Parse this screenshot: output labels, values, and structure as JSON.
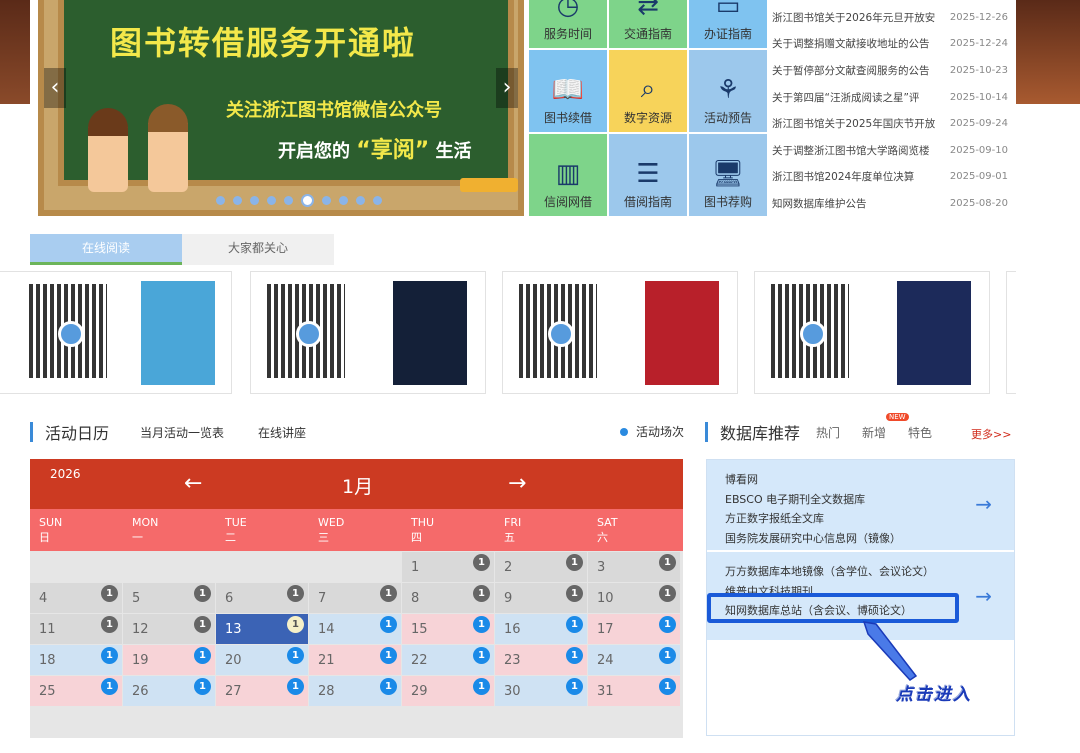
{
  "banner": {
    "title": "图书转借服务开通啦",
    "line1": "关注浙江图书馆微信公众号",
    "line2_pre": "开启您的",
    "line2_hl": "“享阅”",
    "line2_post": "生活",
    "dot_count": 10,
    "active_dot": 5
  },
  "tiles": [
    {
      "label": "服务时间",
      "icon": "clock-icon",
      "color": "t-green",
      "glyph": "◷"
    },
    {
      "label": "交通指南",
      "icon": "traffic-icon",
      "color": "t-green",
      "glyph": "⇄"
    },
    {
      "label": "办证指南",
      "icon": "card-icon",
      "color": "t-blue",
      "glyph": "▭"
    },
    {
      "label": "图书续借",
      "icon": "book-icon",
      "color": "t-blue",
      "glyph": "📖"
    },
    {
      "label": "数字资源",
      "icon": "search-icon",
      "color": "t-yellow",
      "glyph": "⌕"
    },
    {
      "label": "活动预告",
      "icon": "people-icon",
      "color": "t-lblue",
      "glyph": "⚘"
    },
    {
      "label": "信阅网借",
      "icon": "library-icon",
      "color": "t-green",
      "glyph": "▥"
    },
    {
      "label": "借阅指南",
      "icon": "guide-icon",
      "color": "t-lblue",
      "glyph": "☰"
    },
    {
      "label": "图书荐购",
      "icon": "computer-icon",
      "color": "t-lblue",
      "glyph": "🖥"
    }
  ],
  "news": [
    {
      "title": "浙江图书馆关于2026年元旦开放安",
      "date": "2025-12-26"
    },
    {
      "title": "关于调整捐赠文献接收地址的公告",
      "date": "2025-12-24"
    },
    {
      "title": "关于暂停部分文献查阅服务的公告",
      "date": "2025-10-23"
    },
    {
      "title": "关于第四届“汪浙成阅读之星”评",
      "date": "2025-10-14"
    },
    {
      "title": "浙江图书馆关于2025年国庆节开放",
      "date": "2025-09-24"
    },
    {
      "title": "关于调整浙江图书馆大学路阅览楼",
      "date": "2025-09-10"
    },
    {
      "title": "浙江图书馆2024年度单位决算",
      "date": "2025-09-01"
    },
    {
      "title": "知网数据库维护公告",
      "date": "2025-08-20"
    }
  ],
  "reading_tabs": [
    "在线阅读",
    "大家都关心"
  ],
  "books": [
    {
      "cover_color": "#4aa6d8"
    },
    {
      "cover_color": "#142038"
    },
    {
      "cover_color": "#b8202a"
    },
    {
      "cover_color": "#1c2a5a"
    }
  ],
  "activity": {
    "title": "活动日历",
    "links": [
      "当月活动一览表",
      "在线讲座"
    ],
    "legend": "活动场次"
  },
  "calendar": {
    "year": "2026",
    "month": "1月",
    "prev": "←",
    "next": "→",
    "weekdays": [
      {
        "en": "SUN",
        "zh": "日"
      },
      {
        "en": "MON",
        "zh": "一"
      },
      {
        "en": "TUE",
        "zh": "二"
      },
      {
        "en": "WED",
        "zh": "三"
      },
      {
        "en": "THU",
        "zh": "四"
      },
      {
        "en": "FRI",
        "zh": "五"
      },
      {
        "en": "SAT",
        "zh": "六"
      }
    ],
    "days": [
      {
        "d": "",
        "t": "empty"
      },
      {
        "d": "",
        "t": "empty"
      },
      {
        "d": "",
        "t": "empty"
      },
      {
        "d": "",
        "t": "empty"
      },
      {
        "d": "1",
        "t": "g",
        "n": "1",
        "bc": "dark"
      },
      {
        "d": "2",
        "t": "g",
        "n": "1",
        "bc": "dark"
      },
      {
        "d": "3",
        "t": "g",
        "n": "1",
        "bc": "dark"
      },
      {
        "d": "4",
        "t": "g",
        "n": "1",
        "bc": "dark"
      },
      {
        "d": "5",
        "t": "g",
        "n": "1",
        "bc": "dark"
      },
      {
        "d": "6",
        "t": "g",
        "n": "1",
        "bc": "dark"
      },
      {
        "d": "7",
        "t": "g",
        "n": "1",
        "bc": "dark"
      },
      {
        "d": "8",
        "t": "g",
        "n": "1",
        "bc": "dark"
      },
      {
        "d": "9",
        "t": "g",
        "n": "1",
        "bc": "dark"
      },
      {
        "d": "10",
        "t": "g",
        "n": "1",
        "bc": "dark"
      },
      {
        "d": "11",
        "t": "g",
        "n": "1",
        "bc": "dark"
      },
      {
        "d": "12",
        "t": "g",
        "n": "1",
        "bc": "dark"
      },
      {
        "d": "13",
        "t": "today",
        "n": "1",
        "bc": "light"
      },
      {
        "d": "14",
        "t": "b",
        "n": "1",
        "bc": "blue"
      },
      {
        "d": "15",
        "t": "p",
        "n": "1",
        "bc": "blue"
      },
      {
        "d": "16",
        "t": "b",
        "n": "1",
        "bc": "blue"
      },
      {
        "d": "17",
        "t": "p",
        "n": "1",
        "bc": "blue"
      },
      {
        "d": "18",
        "t": "b",
        "n": "1",
        "bc": "blue"
      },
      {
        "d": "19",
        "t": "p",
        "n": "1",
        "bc": "blue"
      },
      {
        "d": "20",
        "t": "b",
        "n": "1",
        "bc": "blue"
      },
      {
        "d": "21",
        "t": "p",
        "n": "1",
        "bc": "blue"
      },
      {
        "d": "22",
        "t": "b",
        "n": "1",
        "bc": "blue"
      },
      {
        "d": "23",
        "t": "p",
        "n": "1",
        "bc": "blue"
      },
      {
        "d": "24",
        "t": "b",
        "n": "1",
        "bc": "blue"
      },
      {
        "d": "25",
        "t": "p",
        "n": "1",
        "bc": "blue"
      },
      {
        "d": "26",
        "t": "b",
        "n": "1",
        "bc": "blue"
      },
      {
        "d": "27",
        "t": "p",
        "n": "1",
        "bc": "blue"
      },
      {
        "d": "28",
        "t": "b",
        "n": "1",
        "bc": "blue"
      },
      {
        "d": "29",
        "t": "p",
        "n": "1",
        "bc": "blue"
      },
      {
        "d": "30",
        "t": "b",
        "n": "1",
        "bc": "blue"
      },
      {
        "d": "31",
        "t": "p",
        "n": "1",
        "bc": "blue"
      }
    ]
  },
  "database": {
    "title": "数据库推荐",
    "tabs": [
      "热门",
      "新增",
      "特色"
    ],
    "new_badge": "NEW",
    "more": "更多>>",
    "block1": [
      "博看网",
      "EBSCO 电子期刊全文数据库",
      "方正数字报纸全文库",
      "国务院发展研究中心信息网（镜像）"
    ],
    "block2": [
      "万方数据库本地镜像（含学位、会议论文）",
      "维普中文科技期刊",
      "知网数据库总站（含会议、博硕论文）"
    ],
    "arrow": "→"
  },
  "annotation": "点击进入",
  "colors": {
    "accent": "#3a8ad8",
    "calendar_header": "#cc3a22",
    "highlight": "#1a5ad8"
  }
}
